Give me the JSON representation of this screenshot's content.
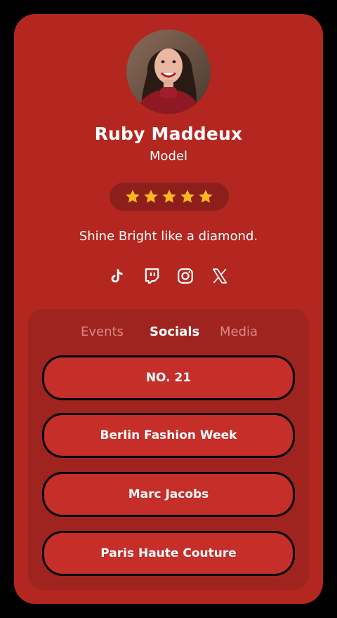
{
  "profile": {
    "name": "Ruby Maddeux",
    "role": "Model",
    "rating_stars": 5,
    "tagline": "Shine Bright like a diamond."
  },
  "socials": [
    {
      "icon": "tiktok-icon"
    },
    {
      "icon": "twitch-icon"
    },
    {
      "icon": "instagram-icon"
    },
    {
      "icon": "x-icon"
    }
  ],
  "tabs": {
    "events": "Events",
    "socials": "Socials",
    "media": "Media",
    "active": "Socials"
  },
  "links": [
    {
      "label": "NO. 21"
    },
    {
      "label": "Berlin Fashion Week"
    },
    {
      "label": "Marc Jacobs"
    },
    {
      "label": "Paris Haute Couture"
    }
  ],
  "colors": {
    "background": "#B32720",
    "panel": "#9f2420",
    "button": "#C62E2A",
    "star": "#FFB81C"
  }
}
